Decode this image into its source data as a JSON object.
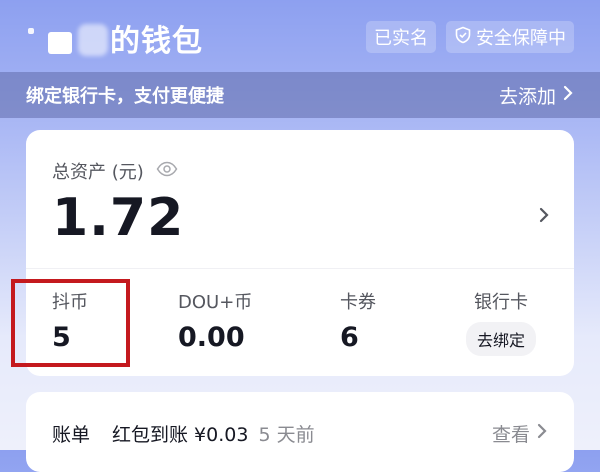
{
  "header": {
    "name_redacted": "(blurred)",
    "title": "的钱包",
    "badges": [
      {
        "label": "已实名",
        "icon": ""
      },
      {
        "label": "安全保障中",
        "icon": "shield-icon"
      }
    ]
  },
  "banner": {
    "text": "绑定银行卡，支付更便捷",
    "action": "去添加",
    "action_icon": "chevron-right-icon"
  },
  "assets": {
    "label": "总资产 (元)",
    "label_icon": "eye-icon",
    "value": "1.72"
  },
  "stats": [
    {
      "label": "抖币",
      "value": "5"
    },
    {
      "label": "DOU+币",
      "value": "0.00"
    },
    {
      "label": "卡券",
      "value": "6"
    },
    {
      "label": "银行卡",
      "button": "去绑定"
    }
  ],
  "bill": {
    "label": "账单",
    "text": "红包到账 ¥0.03",
    "time": "5 天前",
    "action": "查看"
  },
  "colors": {
    "highlight": "#c4191e",
    "background_top": "#8da0f0",
    "text_primary": "#161823"
  }
}
